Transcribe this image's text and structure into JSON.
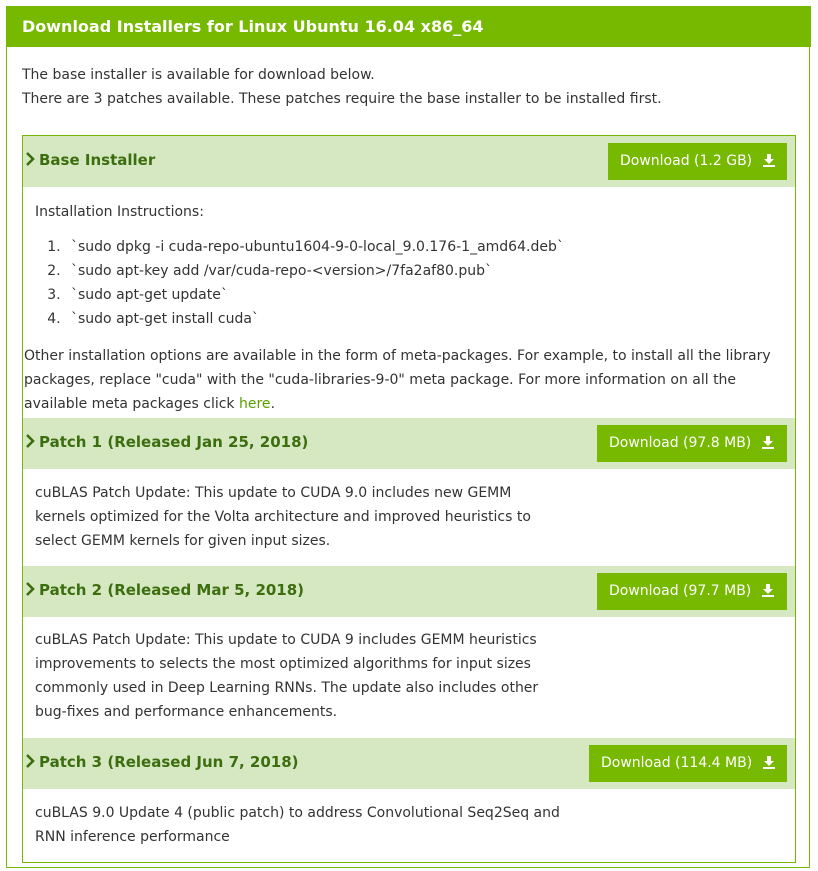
{
  "header": {
    "title": "Download Installers for Linux Ubuntu 16.04 x86_64"
  },
  "intro": {
    "line1": "The base installer is available for download below.",
    "line2": "There are 3 patches available. These patches require the base installer to be installed first."
  },
  "base": {
    "title": "Base Installer",
    "download_label": "Download (1.2 GB)",
    "instructions_label": "Installation Instructions:",
    "steps": [
      "`sudo dpkg -i cuda-repo-ubuntu1604-9-0-local_9.0.176-1_amd64.deb`",
      "`sudo apt-key add /var/cuda-repo-<version>/7fa2af80.pub`",
      "`sudo apt-get update`",
      "`sudo apt-get install cuda`"
    ],
    "other_text": "Other installation options are available in the form of meta-packages. For example, to install all the library packages, replace \"cuda\" with the \"cuda-libraries-9-0\" meta package. For more information on all the available meta packages click",
    "link_text": "here",
    "period": "."
  },
  "patches": [
    {
      "title": "Patch 1 (Released Jan 25, 2018)",
      "download_label": "Download (97.8 MB)",
      "description": "cuBLAS Patch Update: This update to CUDA 9.0 includes new GEMM kernels optimized for the Volta architecture and improved heuristics to select GEMM kernels for given input sizes."
    },
    {
      "title": "Patch 2 (Released Mar 5, 2018)",
      "download_label": "Download (97.7 MB)",
      "description": "cuBLAS Patch Update: This update to CUDA 9 includes GEMM heuristics improvements to selects the most optimized algorithms for input sizes commonly used in Deep Learning RNNs. The update also includes other bug-fixes and performance enhancements."
    },
    {
      "title": "Patch 3 (Released Jun 7, 2018)",
      "download_label": "Download (114.4 MB)",
      "description": "cuBLAS 9.0 Update 4 (public patch) to address Convolutional Seq2Seq and RNN inference performance"
    }
  ],
  "colors": {
    "brand_green": "#76b900",
    "section_bg": "#d5e8c1",
    "section_title": "#3c6e0f"
  },
  "icons": {
    "expand": "chevron-right-icon",
    "download": "download-icon"
  }
}
